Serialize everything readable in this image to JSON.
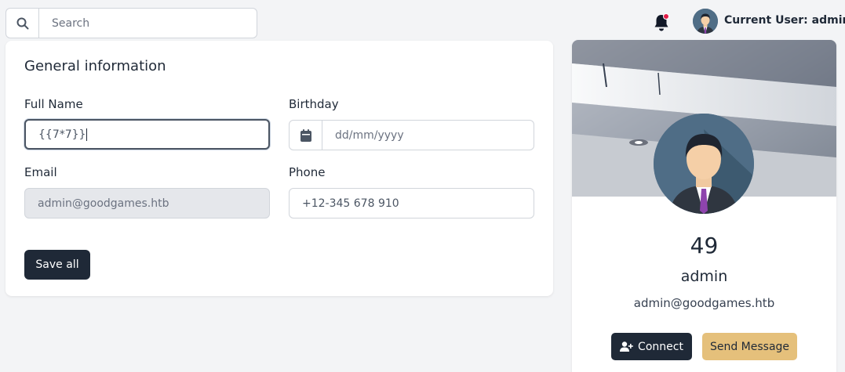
{
  "header": {
    "search_placeholder": "Search",
    "user_label": "Current User: admin",
    "icons": {
      "search": "search-icon",
      "notifications": "bell-icon"
    }
  },
  "general_info": {
    "title": "General information",
    "full_name": {
      "label": "Full Name",
      "value": "{{7*7}}"
    },
    "birthday": {
      "label": "Birthday",
      "placeholder": "dd/mm/yyyy"
    },
    "email": {
      "label": "Email",
      "value": "admin@goodgames.htb"
    },
    "phone": {
      "label": "Phone",
      "value": "+12-345 678 910"
    },
    "save_label": "Save all"
  },
  "profile": {
    "count": "49",
    "name": "admin",
    "email": "admin@goodgames.htb",
    "connect_label": "Connect",
    "message_label": "Send Message"
  },
  "colors": {
    "primary_dark": "#1f2937",
    "accent_gold": "#e5c07b",
    "notification_dot": "#e11d48"
  }
}
